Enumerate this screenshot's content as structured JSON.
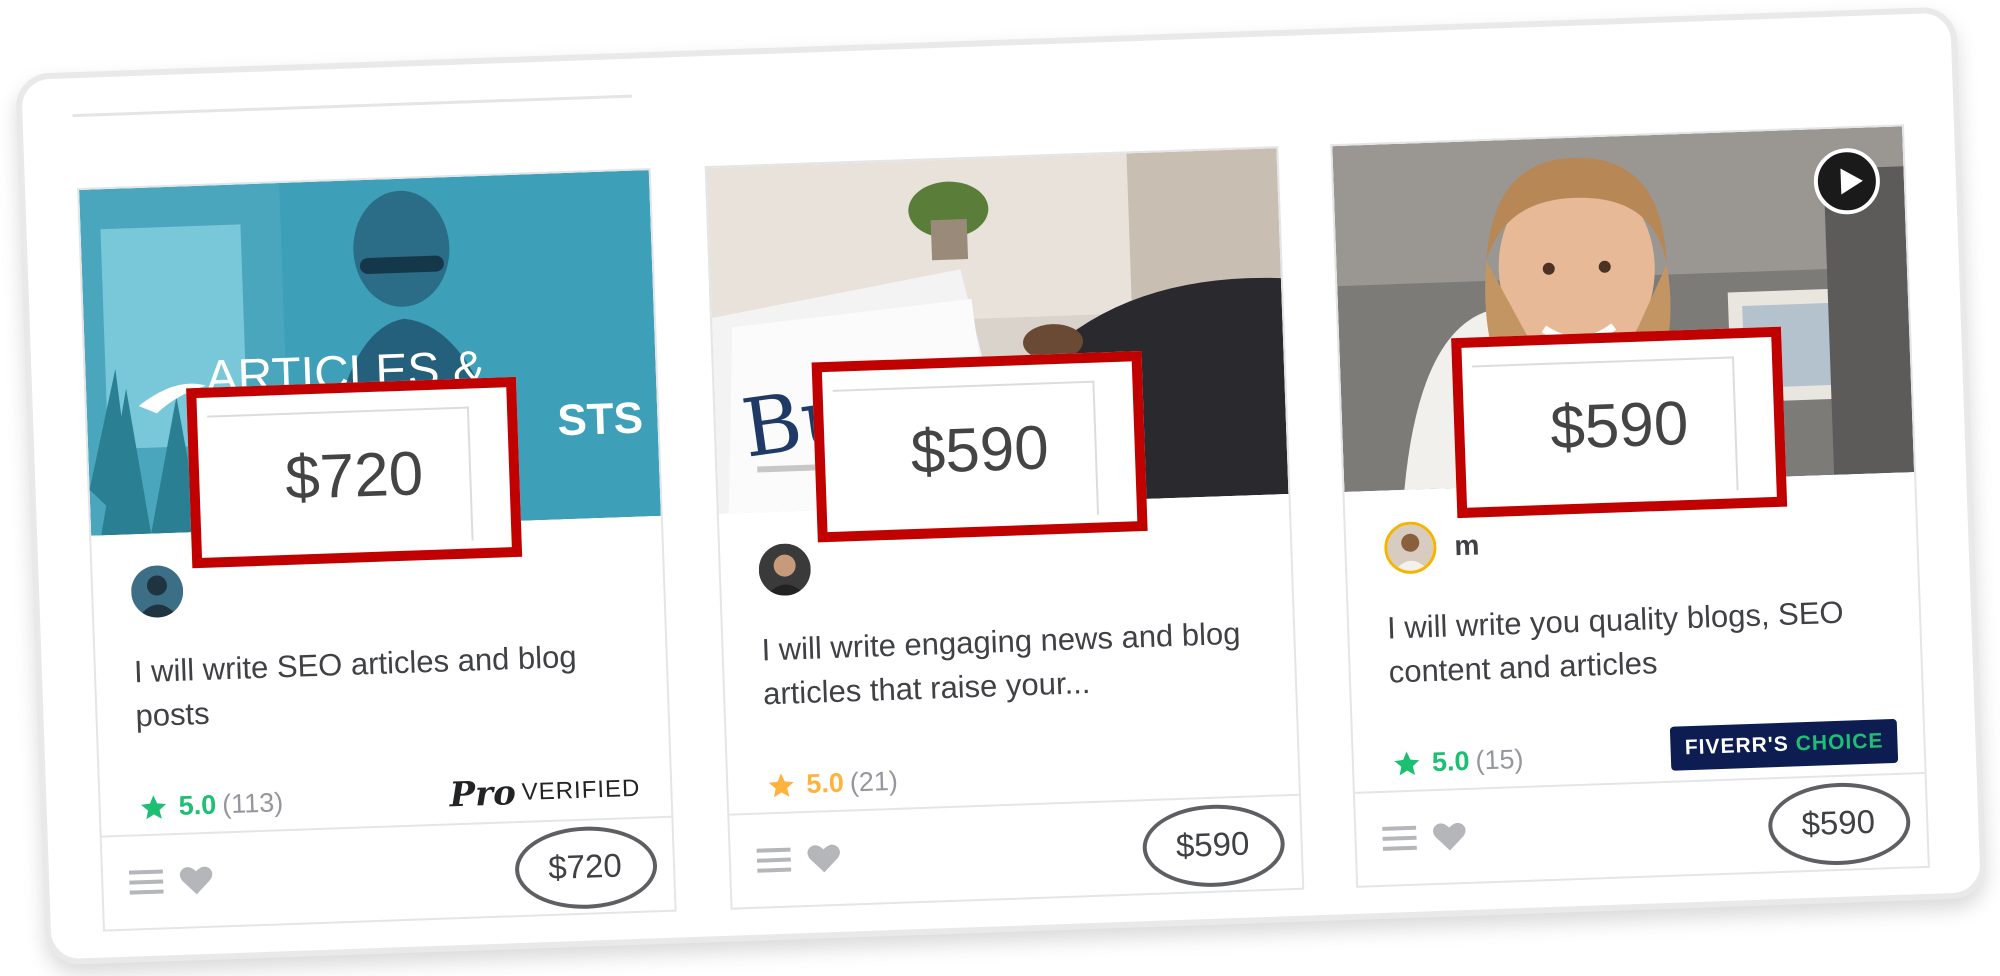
{
  "colors": {
    "rating_green": "#1dbf73",
    "rating_gold": "#ffb33e",
    "highlight_red": "#c10000",
    "choice_badge_bg": "#0d1d51"
  },
  "cards": [
    {
      "thumbnail_text": [
        "ARTICLES &",
        "STS"
      ],
      "callout_price": "$720",
      "title": "I will write SEO articles and blog posts",
      "rating_value": "5.0",
      "rating_count": "(113)",
      "rating_color": "#1dbf73",
      "badge": {
        "type": "pro",
        "pro_text": "Pro",
        "verified_text": "VERIFIED"
      },
      "price": "$720",
      "icons": [
        "list-icon",
        "heart-icon"
      ]
    },
    {
      "thumbnail_text": [
        "Business"
      ],
      "callout_price": "$590",
      "title": "I will write engaging news and blog articles that raise your...",
      "rating_value": "5.0",
      "rating_count": "(21)",
      "rating_color": "#ffb33e",
      "price": "$590",
      "icons": [
        "list-icon",
        "heart-icon"
      ]
    },
    {
      "seller_name": "m",
      "callout_price": "$590",
      "title": "I will write you quality blogs, SEO content and articles",
      "rating_value": "5.0",
      "rating_count": "(15)",
      "rating_color": "#1dbf73",
      "badge": {
        "type": "choice",
        "text_a": "FIVERR'S",
        "text_b": "CHOICE"
      },
      "price": "$590",
      "icons": [
        "list-icon",
        "heart-icon",
        "play-icon"
      ]
    }
  ]
}
